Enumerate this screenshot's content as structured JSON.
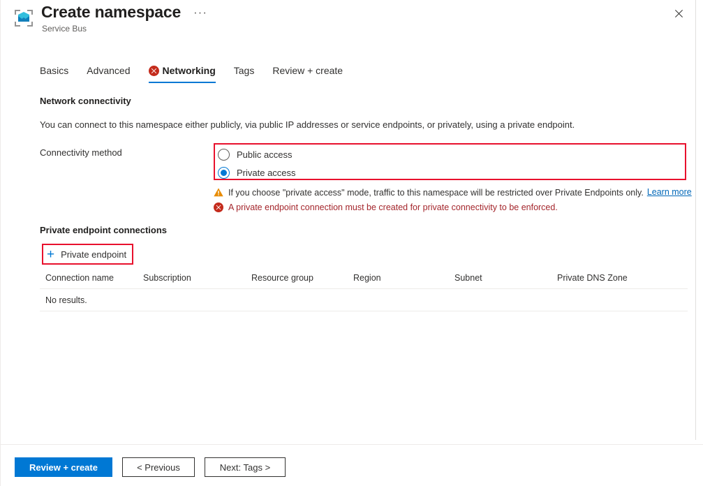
{
  "header": {
    "title": "Create namespace",
    "subtitle": "Service Bus",
    "icon": "service-bus-icon",
    "ellipsis": "···",
    "close_label": "✕"
  },
  "tabs": [
    {
      "label": "Basics",
      "active": false,
      "has_error": false
    },
    {
      "label": "Advanced",
      "active": false,
      "has_error": false
    },
    {
      "label": "Networking",
      "active": true,
      "has_error": true
    },
    {
      "label": "Tags",
      "active": false,
      "has_error": false
    },
    {
      "label": "Review + create",
      "active": false,
      "has_error": false
    }
  ],
  "network_connectivity": {
    "heading": "Network connectivity",
    "description": "You can connect to this namespace either publicly, via public IP addresses or service endpoints, or privately, using a private endpoint.",
    "connectivity_method_label": "Connectivity method",
    "options": [
      {
        "label": "Public access",
        "selected": false
      },
      {
        "label": "Private access",
        "selected": true
      }
    ],
    "warning_message": "If you choose \"private access\" mode, traffic to this namespace will be restricted over Private Endpoints only.",
    "warning_link": "Learn more",
    "error_message": "A private endpoint connection must be created for private connectivity to be enforced."
  },
  "private_endpoint": {
    "heading": "Private endpoint connections",
    "add_button_label": "Private endpoint",
    "add_button_icon": "plus-icon",
    "columns": [
      "Connection name",
      "Subscription",
      "Resource group",
      "Region",
      "Subnet",
      "Private DNS Zone"
    ],
    "rows": [],
    "empty_text": "No results."
  },
  "footer": {
    "review_create": "Review + create",
    "previous": "< Previous",
    "next": "Next: Tags >"
  },
  "colors": {
    "accent": "#0078d4",
    "error": "#a4262c",
    "error_icon": "#c42b1c",
    "warning": "#d83b01",
    "link": "#0067b8",
    "annotation": "#e8112d"
  }
}
